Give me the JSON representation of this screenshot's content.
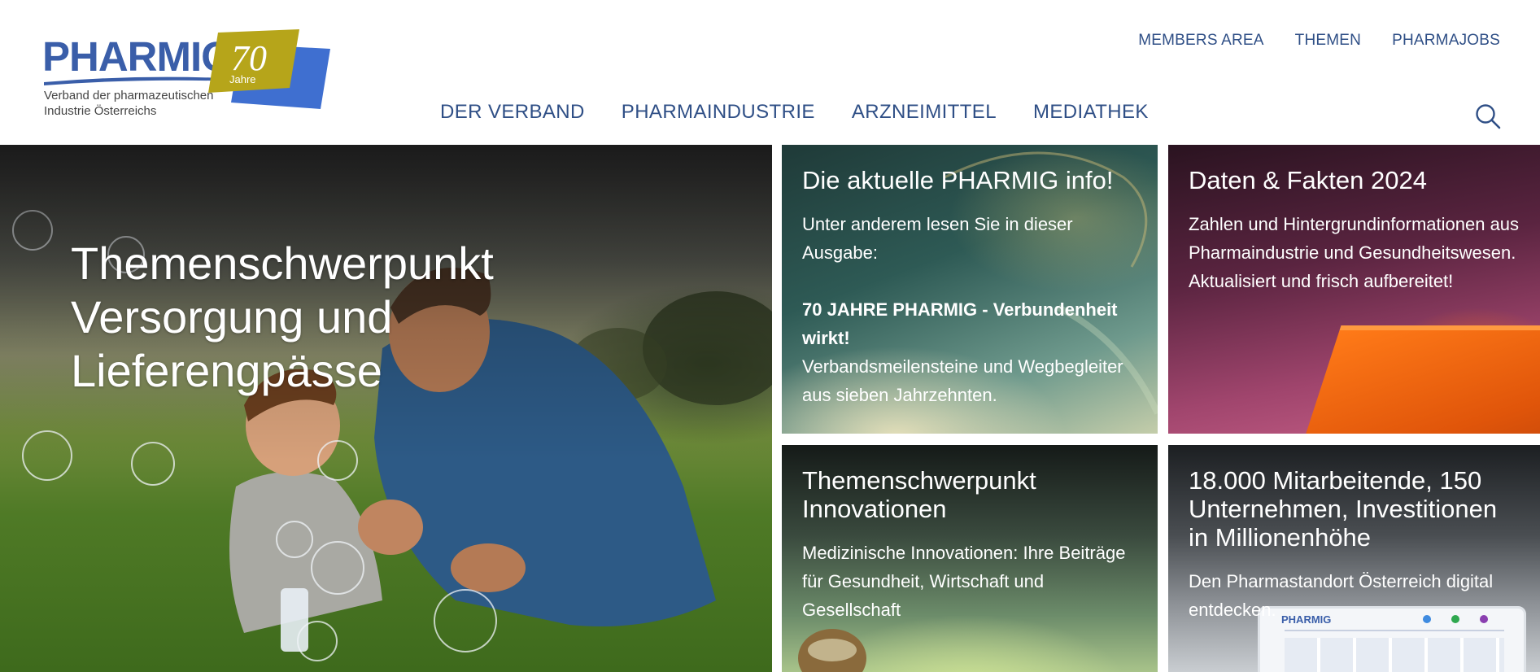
{
  "logo": {
    "word": "PHARMIG",
    "anniversary_number": "70",
    "anniversary_word": "Jahre",
    "tagline_line1": "Verband der pharmazeutischen",
    "tagline_line2": "Industrie Österreichs",
    "colors": {
      "blue": "#3a5ea9",
      "olive": "#b6a51a",
      "badge_blue": "#3f6fd0"
    }
  },
  "topnav": {
    "members": "MEMBERS AREA",
    "themen": "THEMEN",
    "pharmajobs": "PHARMAJOBS"
  },
  "mainnav": {
    "verband": "DER VERBAND",
    "pharmaindustrie": "PHARMAINDUSTRIE",
    "arzneimittel": "ARZNEIMITTEL",
    "mediathek": "MEDIATHEK"
  },
  "search": {
    "icon": "search-icon"
  },
  "hero": {
    "title_line1": "Themenschwerpunkt",
    "title_line2": "Versorgung und",
    "title_line3": "Lieferengpässe"
  },
  "tiles": [
    {
      "title": "Die aktuelle PHARMIG info!",
      "body_intro": "Unter anderem lesen Sie in dieser Ausgabe:",
      "body_strong": "70 JAHRE PHARMIG - Verbundenheit wirkt!",
      "body_after": "Verbandsmeilensteine und Wegbegleiter aus sieben Jahrzehnten."
    },
    {
      "title": "Daten & Fakten 2024",
      "body_line1": "Zahlen und Hintergrundinformationen aus Pharmaindustrie und Gesundheitswesen.",
      "body_line2": "Aktualisiert und frisch aufbereitet!"
    },
    {
      "title": "Themenschwerpunkt Innovationen",
      "body": "Medizinische Innovationen: Ihre Beiträge für Gesundheit, Wirtschaft und Gesellschaft"
    },
    {
      "title": "18.000 Mitarbeitende, 150 Unternehmen, Investitionen in Millionenhöhe",
      "body": "Den Pharmastandort Österreich digital entdecken.",
      "tablet_logo": "PHARMIG"
    }
  ],
  "colors": {
    "nav_text": "#2f4f86",
    "white": "#ffffff"
  }
}
